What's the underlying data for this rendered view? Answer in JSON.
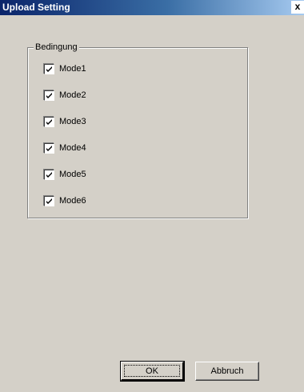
{
  "window": {
    "title": "Upload Setting",
    "close_glyph": "x"
  },
  "group": {
    "label": "Bedingung",
    "options": [
      {
        "label": "Mode1",
        "checked": true
      },
      {
        "label": "Mode2",
        "checked": true
      },
      {
        "label": "Mode3",
        "checked": true
      },
      {
        "label": "Mode4",
        "checked": true
      },
      {
        "label": "Mode5",
        "checked": true
      },
      {
        "label": "Mode6",
        "checked": true
      }
    ]
  },
  "buttons": {
    "ok_label": "OK",
    "cancel_label": "Abbruch"
  },
  "colors": {
    "titlebar_start": "#0a246a",
    "titlebar_end": "#a6caf0",
    "window_bg": "#d4d0c8"
  }
}
